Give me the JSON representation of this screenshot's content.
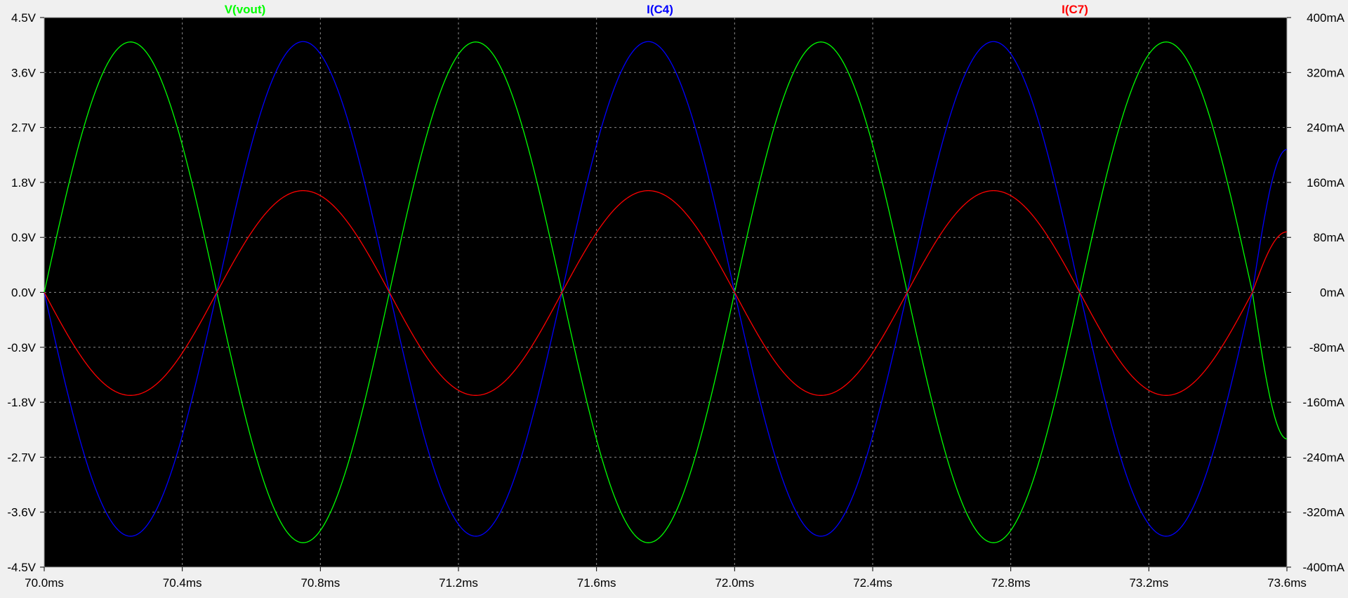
{
  "chart_data": {
    "type": "line",
    "x_unit": "ms",
    "xlim": [
      70.0,
      73.6
    ],
    "x_ticks": [
      "70.0ms",
      "70.4ms",
      "70.8ms",
      "71.2ms",
      "71.6ms",
      "72.0ms",
      "72.4ms",
      "72.8ms",
      "73.2ms",
      "73.6ms"
    ],
    "left_axis": {
      "unit": "V",
      "ylim": [
        -4.5,
        4.5
      ],
      "ticks": [
        "4.5V",
        "3.6V",
        "2.7V",
        "1.8V",
        "0.9V",
        "0.0V",
        "-0.9V",
        "-1.8V",
        "-2.7V",
        "-3.6V",
        "-4.5V"
      ]
    },
    "right_axis": {
      "unit": "mA",
      "ylim": [
        -400,
        400
      ],
      "ticks": [
        "400mA",
        "320mA",
        "240mA",
        "160mA",
        "80mA",
        "0mA",
        "-80mA",
        "-160mA",
        "-240mA",
        "-320mA",
        "-400mA"
      ]
    },
    "grid": true,
    "background": "#000000",
    "series": [
      {
        "name": "V(vout)",
        "axis": "left",
        "color": "#00ff00",
        "x": [
          70.0,
          70.25,
          70.5,
          70.75,
          71.0,
          71.25,
          71.5,
          71.75,
          72.0,
          72.25,
          72.5,
          72.75,
          73.0,
          73.25,
          73.5,
          73.6
        ],
        "values": [
          0.0,
          4.1,
          0.0,
          -4.1,
          0.0,
          4.1,
          0.0,
          -4.1,
          0.0,
          4.1,
          0.0,
          -4.1,
          0.0,
          4.1,
          0.0,
          -2.4
        ]
      },
      {
        "name": "I(C4)",
        "axis": "right",
        "color": "#0000ff",
        "x": [
          70.0,
          70.25,
          70.5,
          70.75,
          71.0,
          71.25,
          71.5,
          71.75,
          72.0,
          72.25,
          72.5,
          72.75,
          73.0,
          73.25,
          73.5,
          73.6
        ],
        "values": [
          0,
          -355,
          0,
          365,
          0,
          -355,
          0,
          365,
          0,
          -355,
          0,
          365,
          0,
          -355,
          0,
          208
        ]
      },
      {
        "name": "I(C7)",
        "axis": "right",
        "color": "#ff0000",
        "x": [
          70.0,
          70.25,
          70.5,
          70.75,
          71.0,
          71.25,
          71.5,
          71.75,
          72.0,
          72.25,
          72.5,
          72.75,
          73.0,
          73.25,
          73.5,
          73.6
        ],
        "values": [
          0,
          -150,
          0,
          148,
          0,
          -150,
          0,
          148,
          0,
          -150,
          0,
          148,
          0,
          -150,
          0,
          88
        ]
      }
    ]
  }
}
